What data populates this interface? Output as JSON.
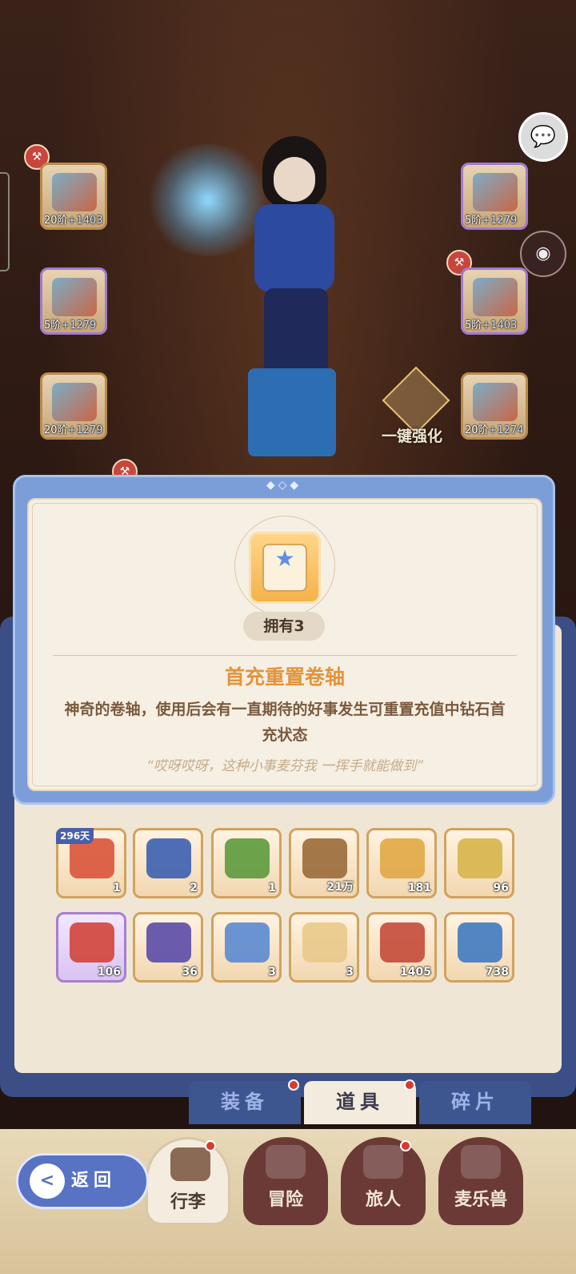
{
  "equipment": {
    "left": [
      {
        "stage": "20阶",
        "power": "+1403"
      },
      {
        "stage": "5阶",
        "power": "+1279"
      },
      {
        "stage": "20阶",
        "power": "+1279"
      }
    ],
    "right": [
      {
        "stage": "5阶",
        "power": "+1279"
      },
      {
        "stage": "5阶",
        "power": "+1403"
      },
      {
        "stage": "20阶",
        "power": "+1274"
      }
    ],
    "enhance_label": "一键强化"
  },
  "popup": {
    "owned": "拥有3",
    "title": "首充重置卷轴",
    "description": "神奇的卷轴，使用后会有一直期待的好事发生可重置充值中钻石首充状态",
    "quote": "“哎呀哎呀，这种小事麦芬我 一挥手就能做到”",
    "ornament": "◆◇◆"
  },
  "inventory": {
    "row1": [
      {
        "count": "1",
        "days": "296天",
        "icon": "red-envelope-icon",
        "color": "#d9543a"
      },
      {
        "count": "2",
        "icon": "blue-map-icon",
        "color": "#3b5fb0"
      },
      {
        "count": "1",
        "icon": "green-ring-icon",
        "color": "#5c9a3c"
      },
      {
        "count": "21万",
        "icon": "wood-planks-icon",
        "color": "#9a6a3a"
      },
      {
        "count": "181",
        "icon": "porridge-bowl-icon",
        "color": "#e0a845"
      },
      {
        "count": "96",
        "icon": "gold-coins-icon",
        "color": "#d6b54a"
      }
    ],
    "row2": [
      {
        "count": "106",
        "icon": "red-dumpling-icon",
        "color": "#d2453a",
        "rarity": "purple"
      },
      {
        "count": "36",
        "icon": "ink-bottle-icon",
        "color": "#5a4ba8"
      },
      {
        "count": "3",
        "icon": "mirror-icon",
        "color": "#5a8ad0"
      },
      {
        "count": "3",
        "icon": "reset-scroll-icon",
        "color": "#e9c98a"
      },
      {
        "count": "1405",
        "icon": "iron-icon",
        "color": "#c44a3a"
      },
      {
        "count": "738",
        "icon": "blue-card-icon",
        "color": "#3f7ac0"
      }
    ]
  },
  "tabs": [
    {
      "label": "装备",
      "active": false
    },
    {
      "label": "道具",
      "active": true
    },
    {
      "label": "碎片",
      "active": false
    }
  ],
  "nav": [
    {
      "label": "行李",
      "active": true
    },
    {
      "label": "冒险",
      "active": false
    },
    {
      "label": "旅人",
      "active": false
    },
    {
      "label": "麦乐兽",
      "active": false
    }
  ],
  "back": {
    "label": "返回"
  },
  "colors": {
    "accent_title": "#e1953c",
    "panel_blue": "#7c9ed8",
    "badge_red": "#d83b2d"
  }
}
